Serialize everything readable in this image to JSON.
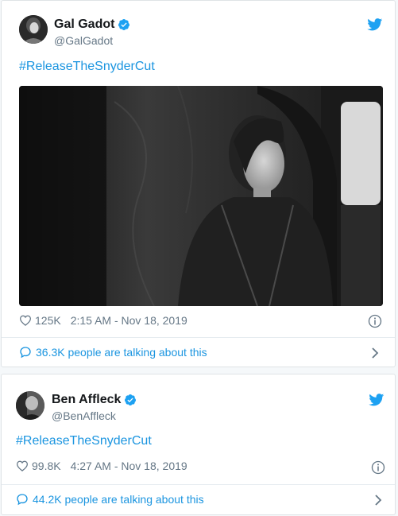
{
  "tweets": [
    {
      "name": "Gal Gadot",
      "handle": "@GalGadot",
      "hashtag": "#ReleaseTheSnyderCut",
      "likes": "125K",
      "timestamp": "2:15 AM - Nov 18, 2019",
      "talking": "36.3K people are talking about this"
    },
    {
      "name": "Ben Affleck",
      "handle": "@BenAffleck",
      "hashtag": "#ReleaseTheSnyderCut",
      "likes": "99.8K",
      "timestamp": "4:27 AM - Nov 18, 2019",
      "talking": "44.2K people are talking about this"
    }
  ],
  "colors": {
    "link": "#1b95e0",
    "secondary_text": "#657786",
    "verified": "#1da1f2",
    "twitter_bird": "#1da1f2"
  },
  "icons": [
    "verified-badge-icon",
    "twitter-bird-icon",
    "heart-icon",
    "info-icon",
    "speech-bubble-icon",
    "chevron-right-icon"
  ]
}
